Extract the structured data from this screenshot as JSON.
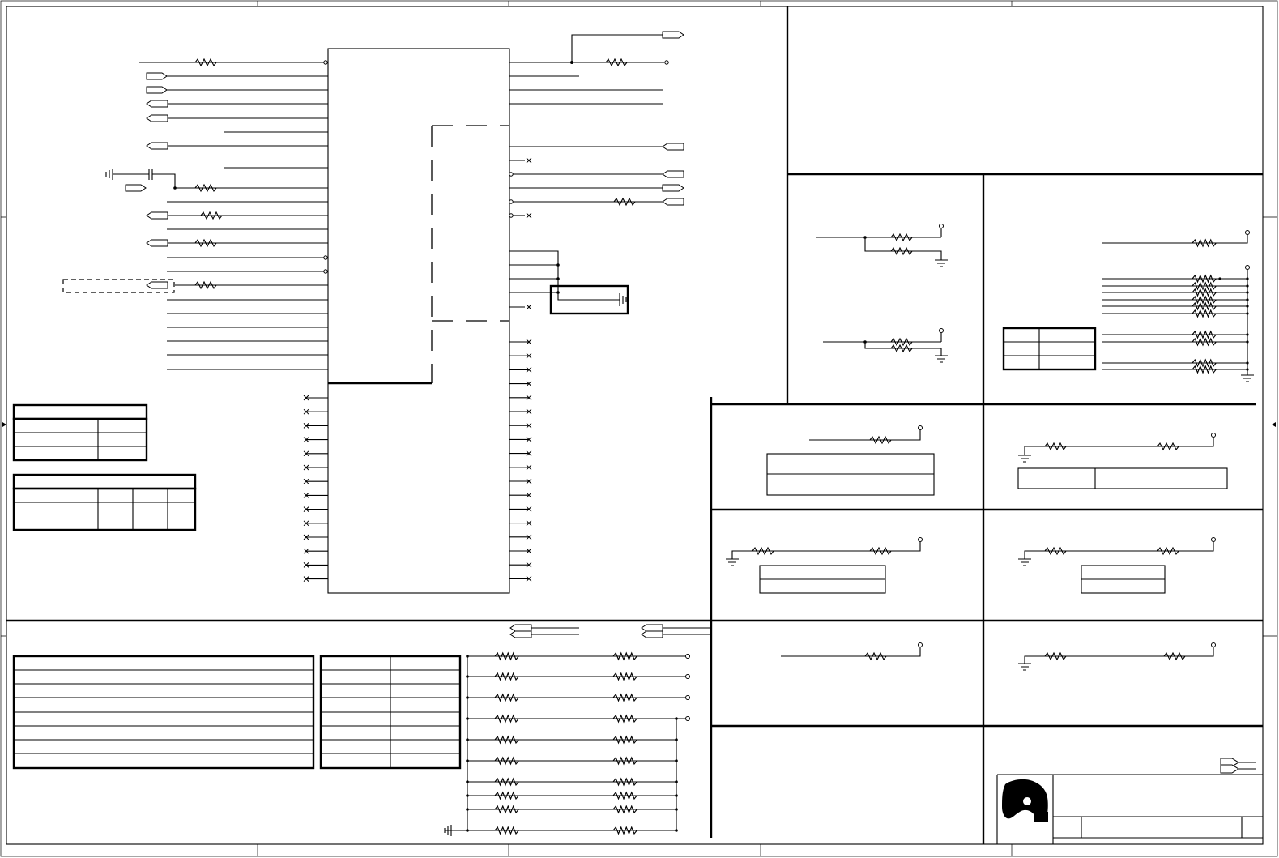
{
  "sheet": {
    "title_block": {
      "logo": "company-logo",
      "fields": []
    },
    "nets": [],
    "components": [],
    "tables": []
  },
  "colors": {
    "line": "#000000",
    "background": "#ffffff"
  }
}
